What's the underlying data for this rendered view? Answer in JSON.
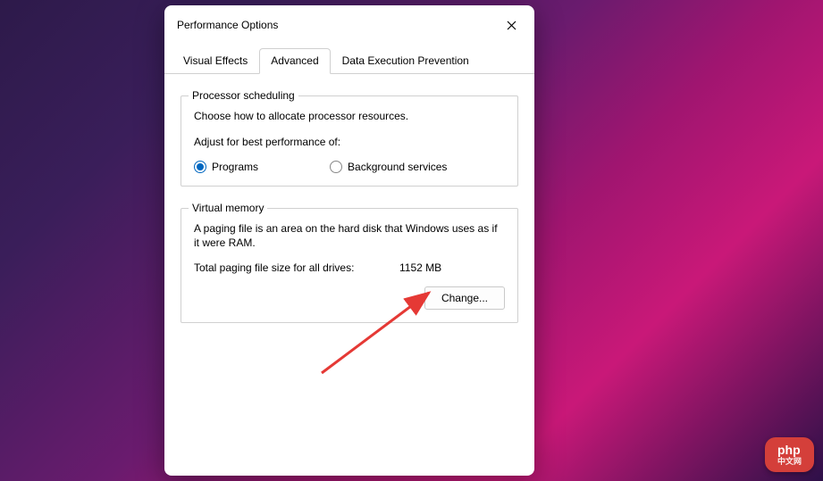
{
  "dialog": {
    "title": "Performance Options"
  },
  "tabs": {
    "visual_effects": "Visual Effects",
    "advanced": "Advanced",
    "dep": "Data Execution Prevention"
  },
  "processor": {
    "group_title": "Processor scheduling",
    "description": "Choose how to allocate processor resources.",
    "adjust_label": "Adjust for best performance of:",
    "programs_label": "Programs",
    "background_label": "Background services"
  },
  "memory": {
    "group_title": "Virtual memory",
    "description": "A paging file is an area on the hard disk that Windows uses as if it were RAM.",
    "total_label": "Total paging file size for all drives:",
    "total_value": "1152 MB",
    "change_button": "Change..."
  },
  "watermark": {
    "main": "php",
    "sub": "中文网"
  }
}
